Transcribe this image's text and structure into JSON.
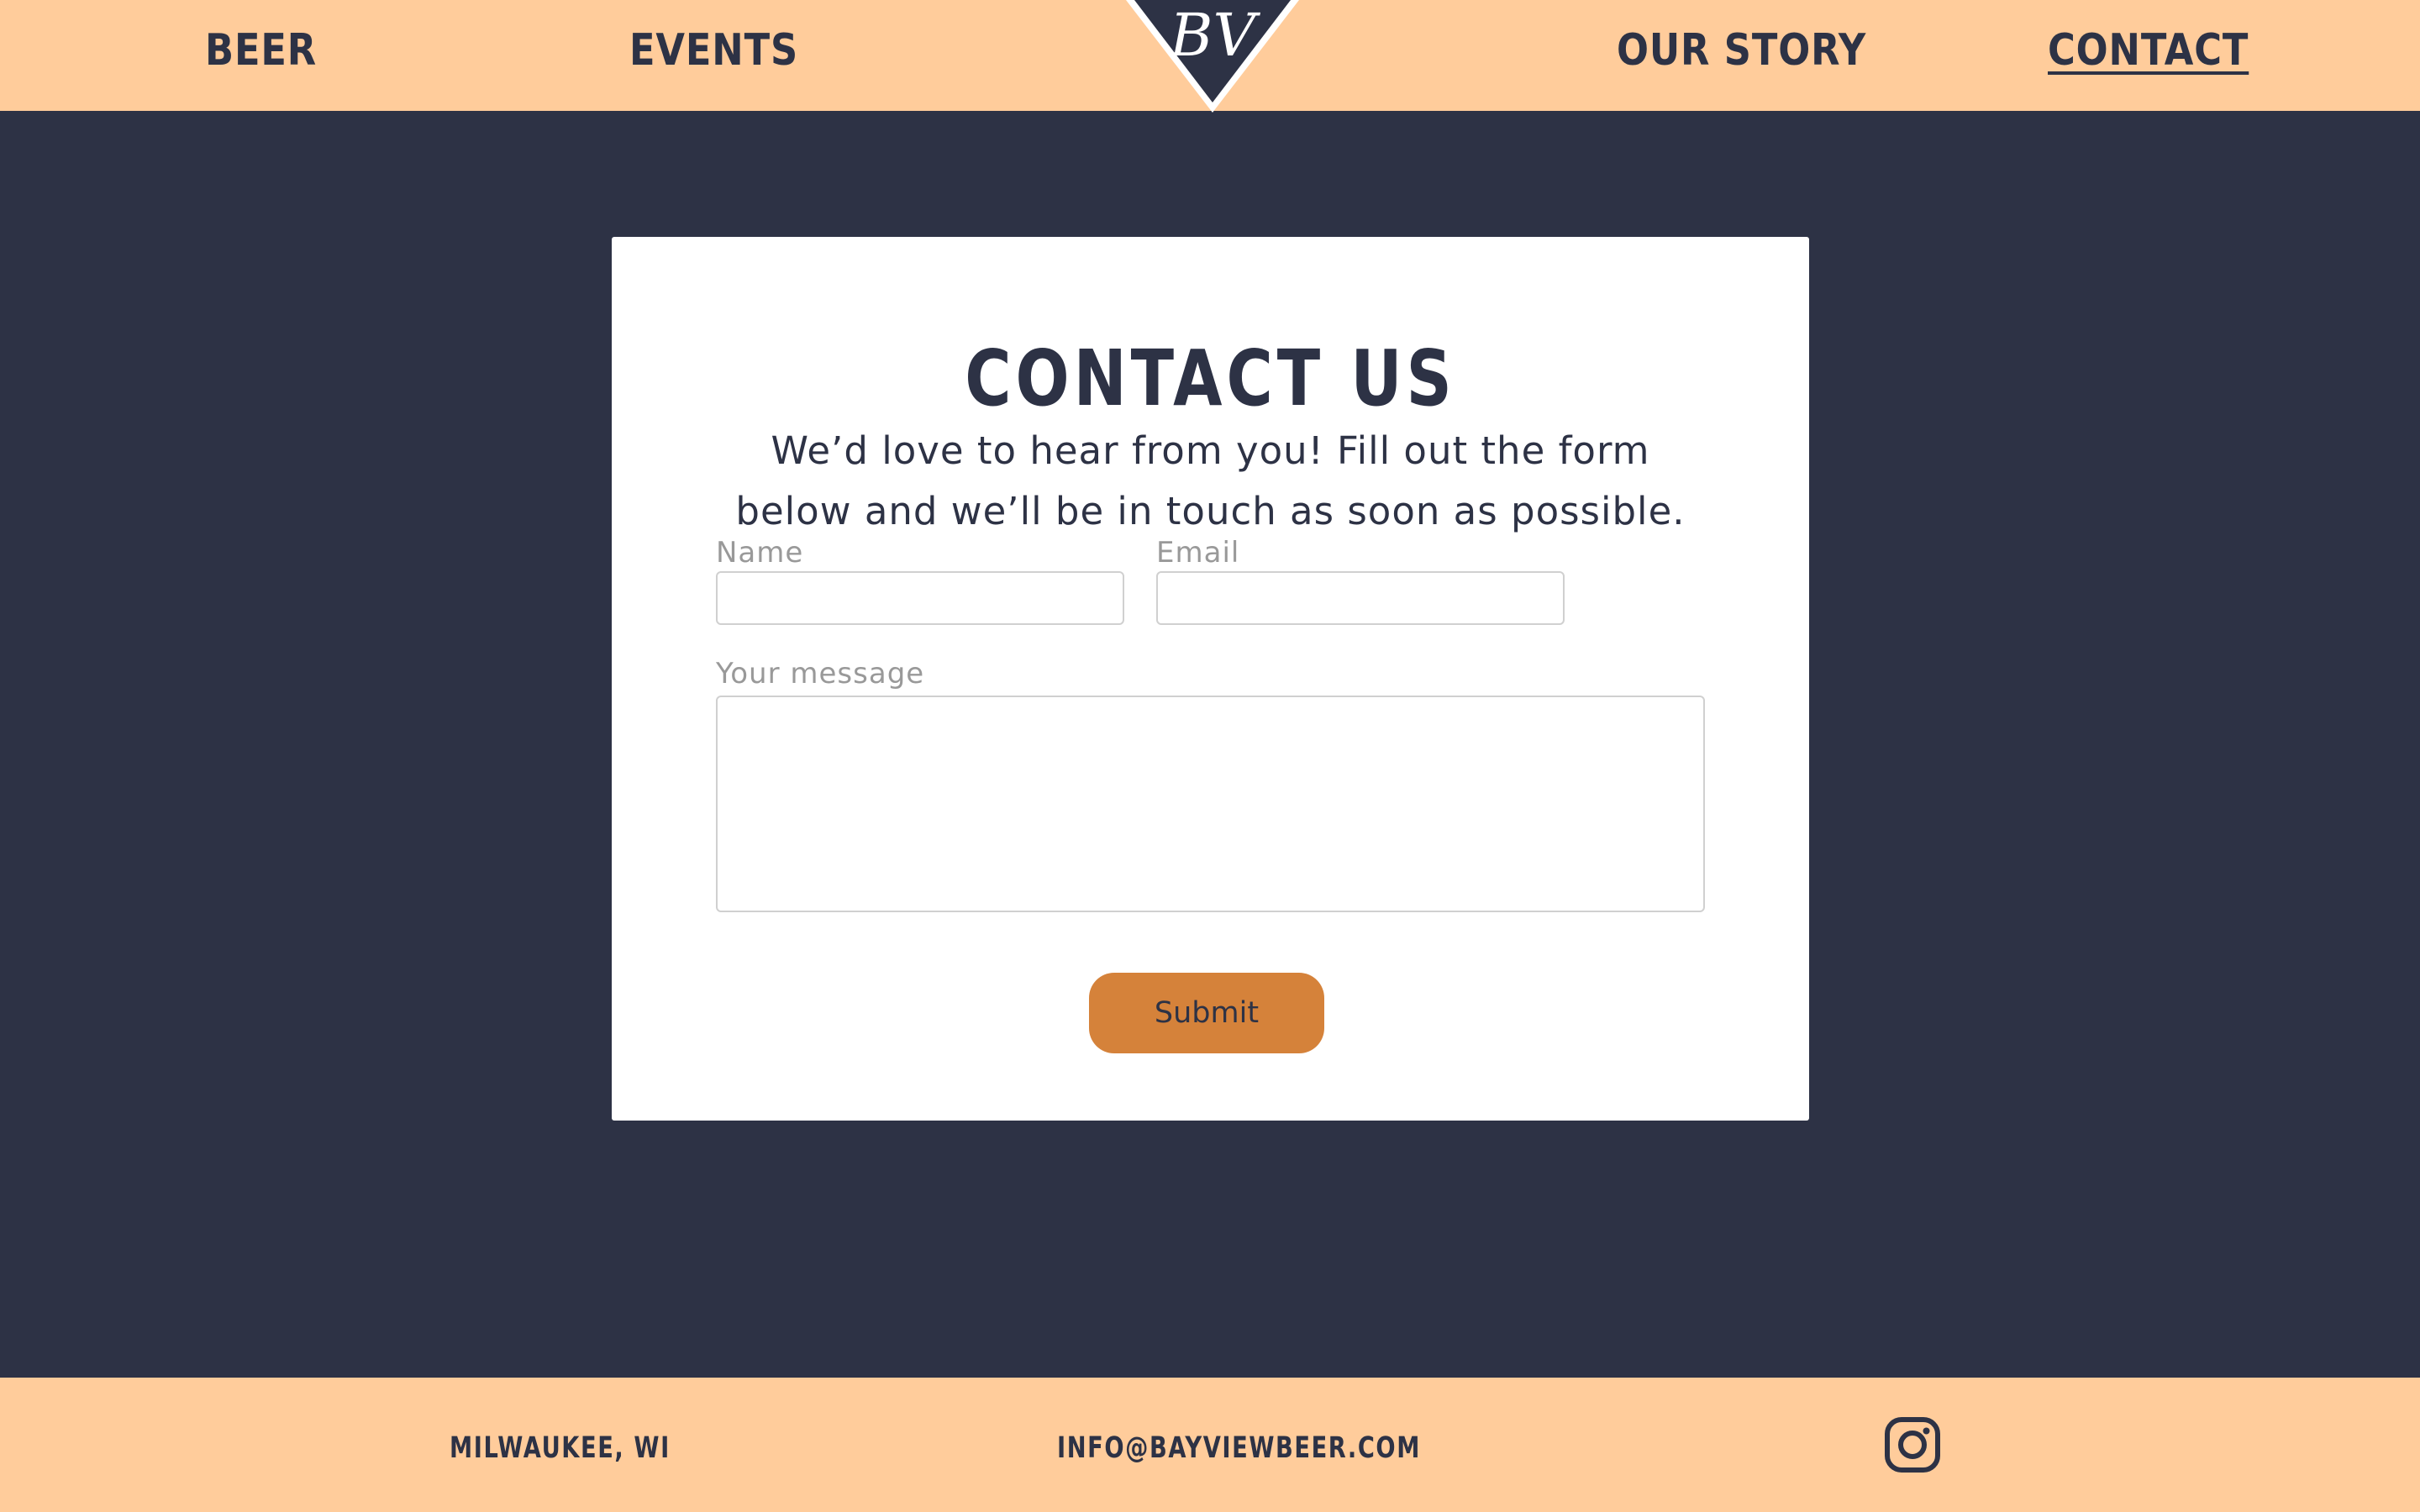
{
  "nav": {
    "beer": "BEER",
    "events": "EVENTS",
    "logo_text": "BV",
    "our_story": "OUR STORY",
    "contact": "CONTACT",
    "active": "contact"
  },
  "contact": {
    "title": "CONTACT US",
    "intro_line1": "We’d love to hear from you!  Fill out the form",
    "intro_line2": "below and we’ll be in touch as soon as possible.",
    "name_label": "Name",
    "name_value": "",
    "email_label": "Email",
    "email_value": "",
    "message_label": "Your message",
    "message_value": "",
    "submit_label": "Submit"
  },
  "footer": {
    "location": "MILWAUKEE, WI",
    "email": "INFO@BAYVIEWBEER.COM",
    "social_icon": "instagram-icon"
  },
  "colors": {
    "nav_background": "#ffcc9b",
    "page_background": "#2d3245",
    "text_dark": "#2d3245",
    "button_background": "#d5823a",
    "label_gray": "#999999"
  }
}
